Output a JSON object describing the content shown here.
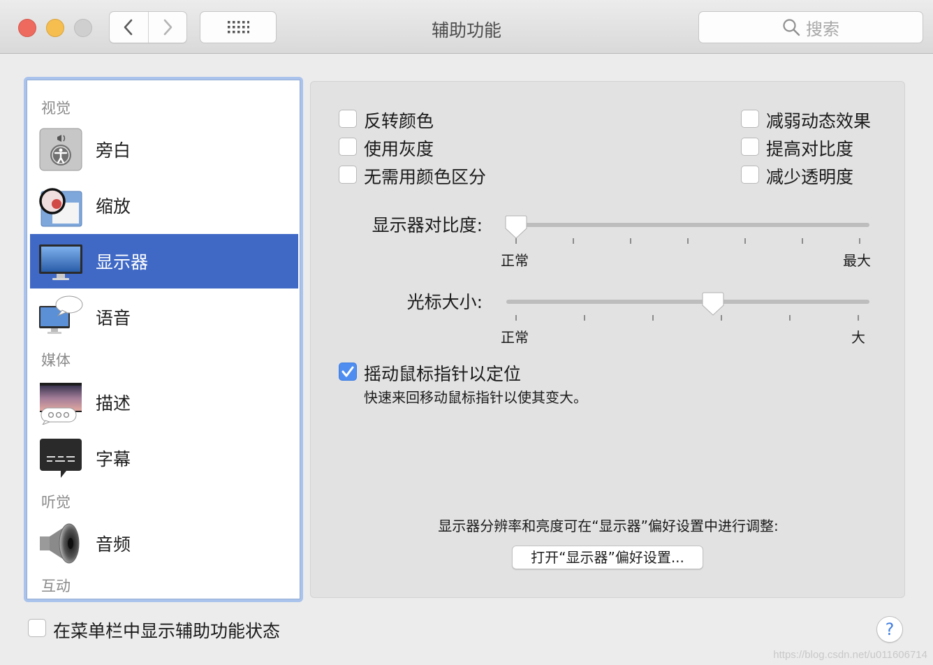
{
  "window": {
    "title": "辅助功能"
  },
  "toolbar": {
    "search_placeholder": "搜索"
  },
  "sidebar": {
    "sections": {
      "visual": "视觉",
      "media": "媒体",
      "hearing": "听觉",
      "interaction": "互动"
    },
    "items": [
      {
        "label": "旁白",
        "icon": "voiceover-icon"
      },
      {
        "label": "缩放",
        "icon": "zoom-icon"
      },
      {
        "label": "显示器",
        "icon": "display-monitor-icon",
        "selected": true
      },
      {
        "label": "语音",
        "icon": "speech-icon"
      },
      {
        "label": "描述",
        "icon": "descriptions-icon"
      },
      {
        "label": "字幕",
        "icon": "captions-icon"
      },
      {
        "label": "音频",
        "icon": "speaker-icon"
      }
    ]
  },
  "display": {
    "options_left": [
      {
        "label": "反转颜色",
        "checked": false
      },
      {
        "label": "使用灰度",
        "checked": false
      },
      {
        "label": "无需用颜色区分",
        "checked": false
      }
    ],
    "options_right": [
      {
        "label": "减弱动态效果",
        "checked": false
      },
      {
        "label": "提高对比度",
        "checked": false
      },
      {
        "label": "减少透明度",
        "checked": false
      }
    ],
    "contrast": {
      "label": "显示器对比度:",
      "min_label": "正常",
      "max_label": "最大",
      "value_fraction": 0.0
    },
    "cursor_size": {
      "label": "光标大小:",
      "min_label": "正常",
      "max_label": "大",
      "value_fraction": 0.57
    },
    "shake": {
      "label": "摇动鼠标指针以定位",
      "checked": true,
      "description": "快速来回移动鼠标指针以使其变大。"
    },
    "note": "显示器分辨率和亮度可在“显示器”偏好设置中进行调整:",
    "open_button": "打开“显示器”偏好设置..."
  },
  "footer": {
    "menubar_status_label": "在菜单栏中显示辅助功能状态",
    "menubar_status_checked": false,
    "help": "?"
  },
  "watermark": "https://blog.csdn.net/u011606714",
  "colors": {
    "selection": "#4069c6",
    "checkbox_on": "#4f8ef0",
    "accent": "#3f7ddf"
  }
}
